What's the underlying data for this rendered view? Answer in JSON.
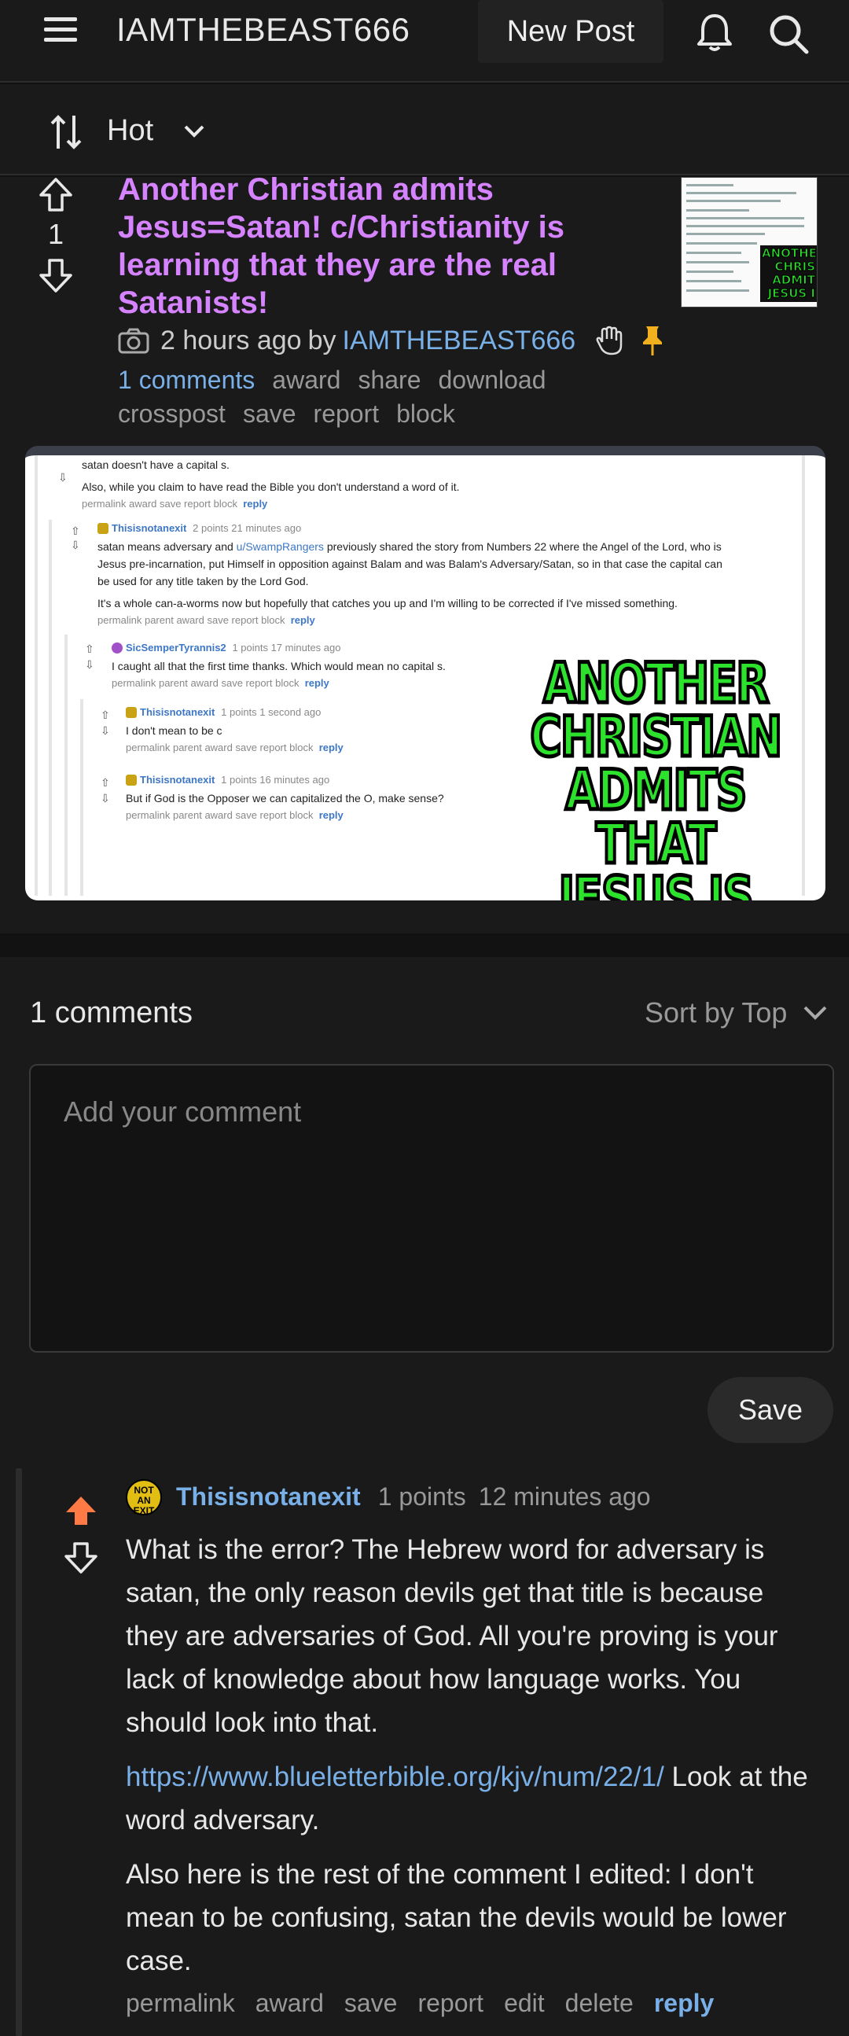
{
  "header": {
    "title": "IAMTHEBEAST666",
    "new_post": "New Post",
    "menu_icon": "hamburger-menu-icon",
    "bell_icon": "bell-icon",
    "search_icon": "search-icon"
  },
  "sort": {
    "label": "Hot",
    "icon": "sort-arrows-icon"
  },
  "post": {
    "score": "1",
    "title": "Another Christian admits Jesus=Satan! c/Christianity is learning that they are the real Satanists!",
    "time": "2 hours ago",
    "by": "by",
    "author": "IAMTHEBEAST666",
    "actions_row1": [
      "1 comments",
      "award",
      "share",
      "download"
    ],
    "actions_row2": [
      "crosspost",
      "save",
      "report",
      "block"
    ],
    "thumbnail_text": "ANOTHER CHRIS ADMIT JESUS I"
  },
  "embed": {
    "line1": "satan doesn't have a capital s.",
    "line2": "Also, while you claim to have read the Bible you don't understand a word of it.",
    "actions_a": "permalink  award  save  report  block",
    "reply": "reply",
    "c1_user": "Thisisnotanexit",
    "c1_meta": "2 points  21 minutes ago",
    "c1_text1": "satan means adversary and",
    "c1_mention": "u/SwampRangers",
    "c1_text1b": "previously shared the story from Numbers 22 where the Angel of the Lord, who is",
    "c1_text2": "Jesus pre-incarnation, put Himself in opposition against Balam and was Balam's Adversary/Satan, so in that case the capital can",
    "c1_text3": "be used for any title taken by the Lord God.",
    "c1_text4": "It's a whole can-a-worms now but hopefully that catches you up and I'm willing to be corrected if I've missed something.",
    "actions_b": "permalink  parent  award  save  report  block",
    "c2_user": "SicSemperTyrannis2",
    "c2_meta": "1 points  17 minutes ago",
    "c2_text": "I caught all that the first time thanks. Which would mean no capital s.",
    "c3_user": "Thisisnotanexit",
    "c3_meta": "1 points  1 second ago",
    "c3_text": "I don't mean to be c",
    "c4_user": "Thisisnotanexit",
    "c4_meta": "1 points  16 minutes ago",
    "c4_text": "But if God is the Opposer we can capitalized the O, make sense?",
    "big_text": "ANOTHER CHRISTIAN ADMITS THAT JESUS IS SATAN"
  },
  "comments": {
    "count": "1 comments",
    "sort": "Sort by Top",
    "placeholder": "Add your comment",
    "save": "Save",
    "items": [
      {
        "avatar_text": "NOT AN EXIT",
        "user": "Thisisnotanexit",
        "points": "1 points",
        "time": "12 minutes ago",
        "para1": "What is the error? The Hebrew word for adversary is satan, the only reason devils get that title is because they are adversaries of God. All you're proving is your lack of knowledge about how language works. You should look into that.",
        "link": "https://www.blueletterbible.org/kjv/num/22/1/",
        "para2_tail": " Look at the word adversary.",
        "para3": "Also here is the rest of the comment I edited: I don't mean to be confusing, satan the devils would be lower case.",
        "actions": [
          "permalink",
          "award",
          "save",
          "report",
          "edit",
          "delete"
        ],
        "reply": "reply"
      }
    ]
  },
  "colors": {
    "title": "#d683ff",
    "link": "#7ab0e8",
    "upvoted": "#ff7a45",
    "background": "#1a1a1b"
  }
}
